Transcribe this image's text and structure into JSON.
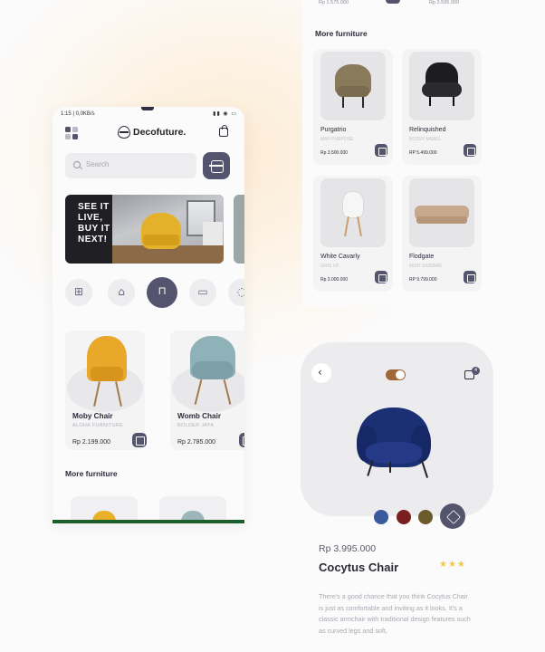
{
  "status_bar": {
    "time": "1:15 | 0,0KB/s",
    "icons": "▮▮ ◉ ▭"
  },
  "brand": {
    "name": "Decofuture."
  },
  "search": {
    "placeholder": "Search"
  },
  "banner": {
    "text": "SEE IT LIVE, BUY IT NEXT!"
  },
  "categories": [
    {
      "icon": "grid-icon",
      "glyph": "⊞",
      "active": false
    },
    {
      "icon": "armchair-icon",
      "glyph": "⌂",
      "active": false
    },
    {
      "icon": "table-icon",
      "glyph": "⊓",
      "active": true
    },
    {
      "icon": "bed-icon",
      "glyph": "▭",
      "active": false
    },
    {
      "icon": "lamp-icon",
      "glyph": "◌",
      "active": false
    }
  ],
  "products": [
    {
      "name": "Moby Chair",
      "subtitle": "ALOHA FURNITURE",
      "price": "Rp 2.199.000",
      "color": "#e9a82a"
    },
    {
      "name": "Womb Chair",
      "subtitle": "BOLDER JAYA",
      "price": "Rp 2.785.000",
      "color": "#8fb1b8"
    }
  ],
  "more_furniture_label": "More furniture",
  "grid_top_stubs": [
    "Rp 1.575.000",
    "Rp 3.595.000"
  ],
  "grid_products": [
    {
      "name": "Purgatrio",
      "subtitle": "MAP PURPOSE",
      "price": "Rp 3.500.000",
      "color": "#8a7a5c"
    },
    {
      "name": "Relinquished",
      "subtitle": "BOSSY MEBEL",
      "price": "RP 5.499.000",
      "color": "#1d1d1f"
    },
    {
      "name": "White Cavarly",
      "subtitle": "GRIS LR",
      "price": "Rp 3.000.000",
      "color": "#f2f2f2"
    },
    {
      "name": "Flodgate",
      "subtitle": "MISH SIDEBAR",
      "price": "RP 9.799.000",
      "color": "#c9a98e"
    }
  ],
  "detail": {
    "cart_count": "4",
    "swatches": [
      "#3a5a9e",
      "#7a1f1f",
      "#6b5a2a"
    ],
    "price": "Rp 3.995.000",
    "name": "Cocytus Chair",
    "rating_stars": "★★★",
    "description": "There's a good chance that you think Cocytus Chair is just as comfortable and inviting as it looks. It's a classic armchair with traditional design features such as curved legs and soft,"
  }
}
